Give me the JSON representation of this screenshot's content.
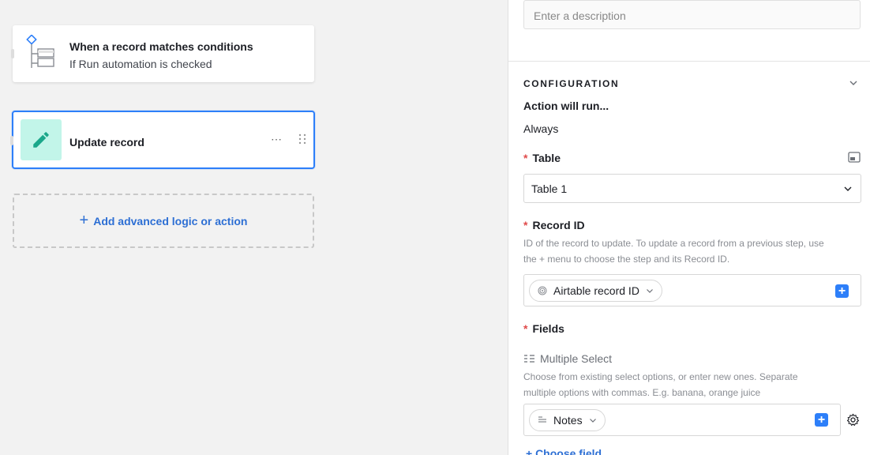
{
  "canvas": {
    "trigger": {
      "title": "When a record matches conditions",
      "subtitle": "If Run automation is checked",
      "icon": "conditions-tree-icon"
    },
    "action": {
      "title": "Update record",
      "icon": "pencil-icon",
      "more_label": "⋯"
    },
    "add_logic_label": "Add advanced logic or action"
  },
  "panel": {
    "description_placeholder": "Enter a description",
    "configuration": {
      "title": "CONFIGURATION",
      "action_will_run_label": "Action will run...",
      "action_will_run_value": "Always"
    },
    "table": {
      "label": "Table",
      "required_mark": "*",
      "value": "Table 1"
    },
    "record_id": {
      "label": "Record ID",
      "required_mark": "*",
      "help_line1": "ID of the record to update. To update a record from a previous step, use",
      "help_line2": "the + menu to choose the step and its Record ID.",
      "token_label": "Airtable record ID"
    },
    "fields": {
      "label": "Fields",
      "required_mark": "*",
      "field_name": "Multiple Select",
      "help_line1": "Choose from existing select options, or enter new ones. Separate",
      "help_line2": "multiple options with commas. E.g. banana, orange juice",
      "token_label": "Notes",
      "choose_field_label": "+ Choose field"
    }
  },
  "colors": {
    "accent": "#2d7ff9",
    "link": "#2d6fd4",
    "required": "#e04b4b",
    "action_icon_bg": "#c2f5e9",
    "action_icon_fg": "#1aa78a"
  }
}
